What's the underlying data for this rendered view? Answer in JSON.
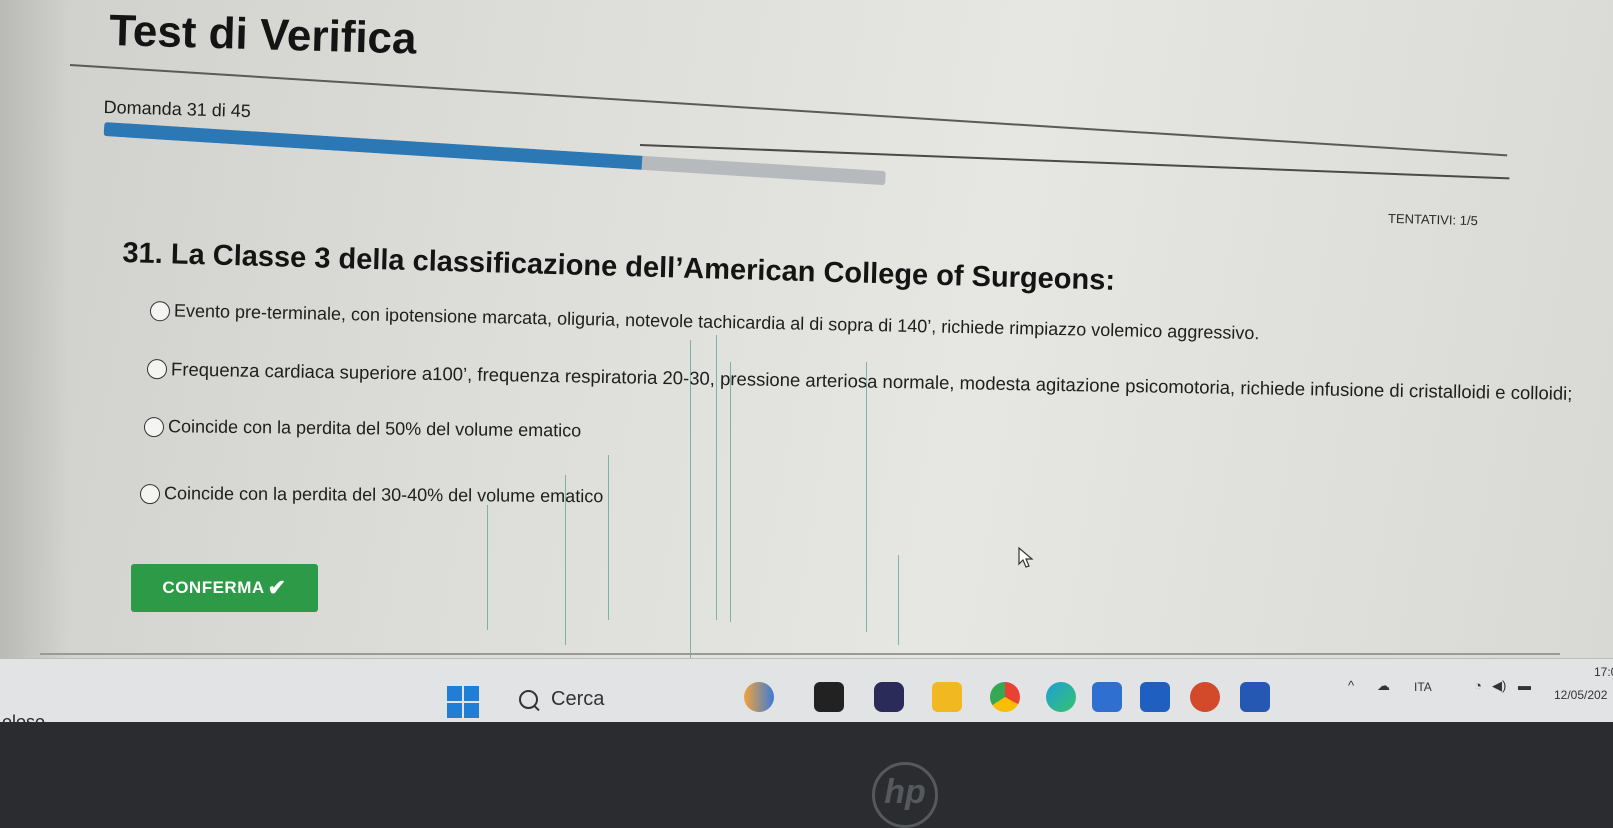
{
  "page": {
    "title": "Test di Verifica",
    "question_counter": "Domanda 31 di 45",
    "progress": {
      "current": 31,
      "total": 45
    },
    "attempts": "TENTATIVI: 1/5"
  },
  "question": {
    "text": "31. La Classe 3 della classificazione dell’American College of Surgeons:",
    "options": [
      {
        "label": "Evento pre-terminale, con ipotensione marcata, oliguria, notevole tachicardia al di sopra di 140’, richiede rimpiazzo volemico aggressivo."
      },
      {
        "label": "Frequenza cardiaca superiore a100’, frequenza respiratoria 20-30, pressione arteriosa normale, modesta agitazione psicomotoria, richiede infusione di cristalloidi e colloidi;"
      },
      {
        "label": "Coincide con la perdita del 50% del volume ematico"
      },
      {
        "label": "Coincide con la perdita del 30-40% del volume ematico"
      }
    ],
    "confirm_label": "CONFERMA",
    "confirm_icon": "check-icon"
  },
  "taskbar": {
    "left_text": "oloso",
    "search_label": "Cerca",
    "language": "ITA",
    "time": "17:0",
    "date": "12/05/202"
  },
  "colors": {
    "progress_fill": "#2b78b5",
    "progress_track": "#b7babd",
    "confirm_button": "#2d9a48",
    "start_icon": "#1f7fd6"
  }
}
